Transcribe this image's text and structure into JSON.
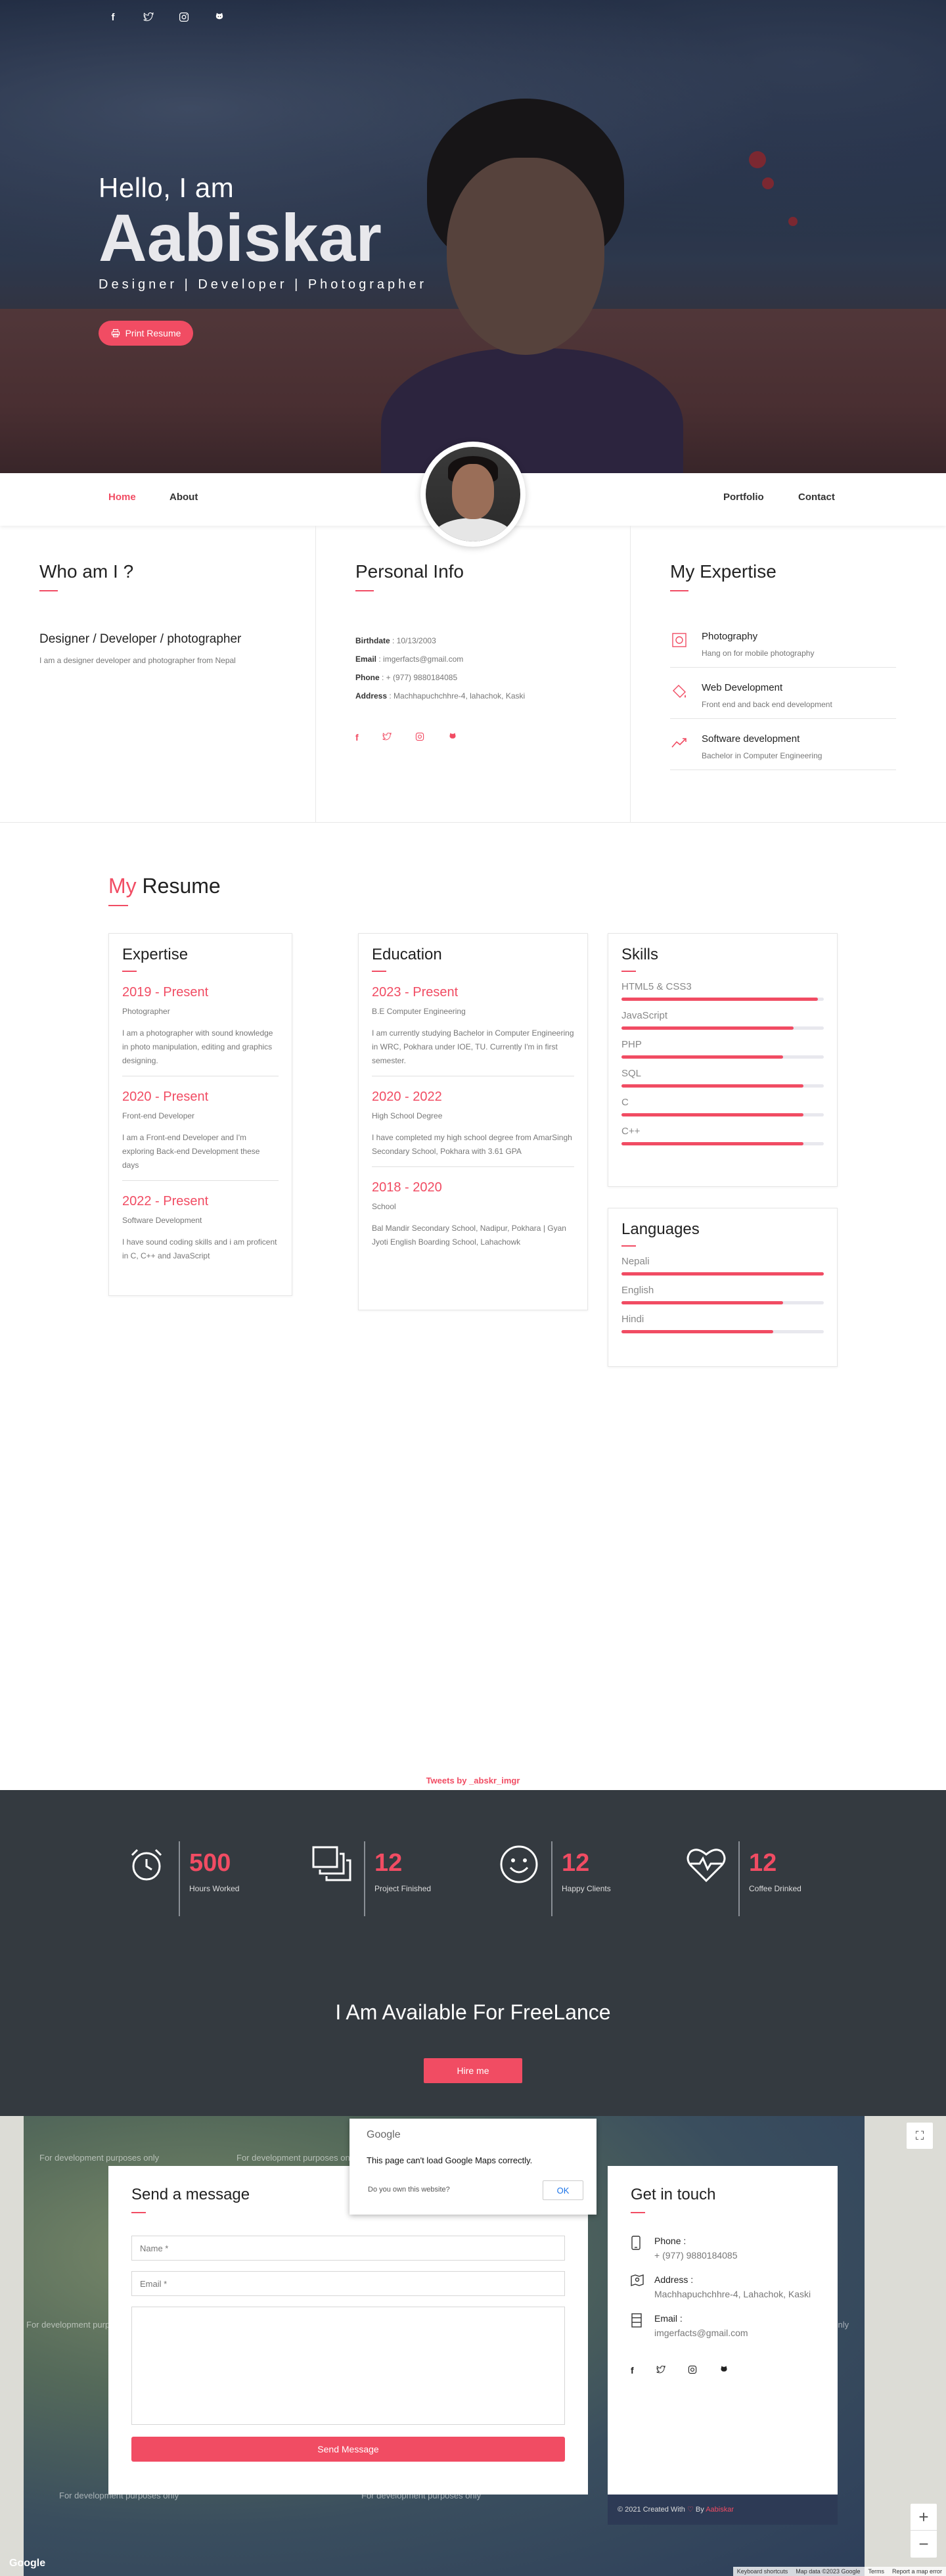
{
  "hero": {
    "hello": "Hello, I am",
    "name": "Aabiskar",
    "roles": "Designer | Developer | Photographer",
    "print_button": "Print Resume",
    "social_icons": [
      "facebook-icon",
      "twitter-icon",
      "instagram-icon",
      "github-icon"
    ]
  },
  "nav": {
    "home": "Home",
    "about": "About",
    "portfolio": "Portfolio",
    "contact": "Contact"
  },
  "about": {
    "who": {
      "heading": "Who am I ?",
      "title": "Designer / Developer / photographer",
      "desc": "I am a designer developer and photographer from Nepal"
    },
    "personal": {
      "heading": "Personal Info",
      "birth_label": "Birthdate",
      "birth_value": ": 10/13/2003",
      "email_label": "Email",
      "email_value": ": imgerfacts@gmail.com",
      "phone_label": "Phone",
      "phone_value": ": + (977) 9880184085",
      "address_label": "Address",
      "address_value": ": Machhapuchchhre-4, lahachok, Kaski"
    },
    "expertise": {
      "heading": "My Expertise",
      "items": [
        {
          "title": "Photography",
          "sub": "Hang on for mobile photography"
        },
        {
          "title": "Web Development",
          "sub": "Front end and back end development"
        },
        {
          "title": "Software development",
          "sub": "Bachelor in Computer Engineering"
        }
      ]
    }
  },
  "resume": {
    "my": "My",
    "title": "Resume",
    "expertise": {
      "heading": "Expertise",
      "entries": [
        {
          "year": "2019 - Present",
          "role": "Photographer",
          "desc": "I am a photographer with sound knowledge in photo manipulation, editing and graphics designing."
        },
        {
          "year": "2020 - Present",
          "role": "Front-end Developer",
          "desc": "I am a Front-end Developer and I'm exploring Back-end Development these days"
        },
        {
          "year": "2022 - Present",
          "role": "Software Development",
          "desc": "I have sound coding skills and i am proficent in C, C++ and JavaScript"
        }
      ]
    },
    "education": {
      "heading": "Education",
      "entries": [
        {
          "year": "2023 - Present",
          "role": "B.E Computer Engineering",
          "desc": "I am currently studying Bachelor in Computer Engineering in WRC, Pokhara under IOE, TU. Currently I'm in first semester."
        },
        {
          "year": "2020 - 2022",
          "role": "High School Degree",
          "desc": "I have completed my high school degree from AmarSingh Secondary School, Pokhara with 3.61 GPA"
        },
        {
          "year": "2018 - 2020",
          "role": "School",
          "desc": "Bal Mandir Secondary School, Nadipur, Pokhara | Gyan Jyoti English Boarding School, Lahachowk"
        }
      ]
    },
    "skills": {
      "heading": "Skills",
      "items": [
        {
          "label": "HTML5 & CSS3",
          "level": 0.97
        },
        {
          "label": "JavaScript",
          "level": 0.85
        },
        {
          "label": "PHP",
          "level": 0.8
        },
        {
          "label": "SQL",
          "level": 0.9
        },
        {
          "label": "C",
          "level": 0.9
        },
        {
          "label": "C++",
          "level": 0.9
        }
      ]
    },
    "languages": {
      "heading": "Languages",
      "items": [
        {
          "label": "Nepali",
          "level": 1.0
        },
        {
          "label": "English",
          "level": 0.8
        },
        {
          "label": "Hindi",
          "level": 0.75
        }
      ]
    }
  },
  "tweets_link": "Tweets by _abskr_imgr",
  "counters": [
    {
      "value": "500",
      "label": "Hours Worked",
      "icon": "alarm-clock-icon"
    },
    {
      "value": "12",
      "label": "Project Finished",
      "icon": "stacked-squares-icon"
    },
    {
      "value": "12",
      "label": "Happy Clients",
      "icon": "smiley-icon"
    },
    {
      "value": "12",
      "label": "Coffee Drinked",
      "icon": "heartbeat-icon"
    }
  ],
  "freelance": {
    "title": "I Am Available For FreeLance",
    "button": "Hire me"
  },
  "map": {
    "dialog_brand": "Google",
    "dialog_message": "This page can't load Google Maps correctly.",
    "dialog_question": "Do you own this website?",
    "dialog_ok": "OK",
    "watermark": "For development purposes only",
    "logo": "Google",
    "attribution": [
      "Keyboard shortcuts",
      "Map data ©2023 Google",
      "Terms",
      "Report a map error"
    ]
  },
  "contact": {
    "send_heading": "Send a message",
    "name_placeholder": "Name *",
    "email_placeholder": "Email *",
    "send_button": "Send Message",
    "touch_heading": "Get in touch",
    "phone_label": "Phone :",
    "phone_value": "+ (977) 9880184085",
    "address_label": "Address :",
    "address_value": "Machhapuchchhre-4, Lahachok, Kaski",
    "email_label": "Email :",
    "email_value": "imgerfacts@gmail.com"
  },
  "footer": {
    "created": "© 2021 Created With",
    "by": "By",
    "author": "Aabiskar"
  },
  "colors": {
    "accent": "#f14c63",
    "dark_band": "#343a40",
    "footer_bar": "#2d3a55"
  }
}
